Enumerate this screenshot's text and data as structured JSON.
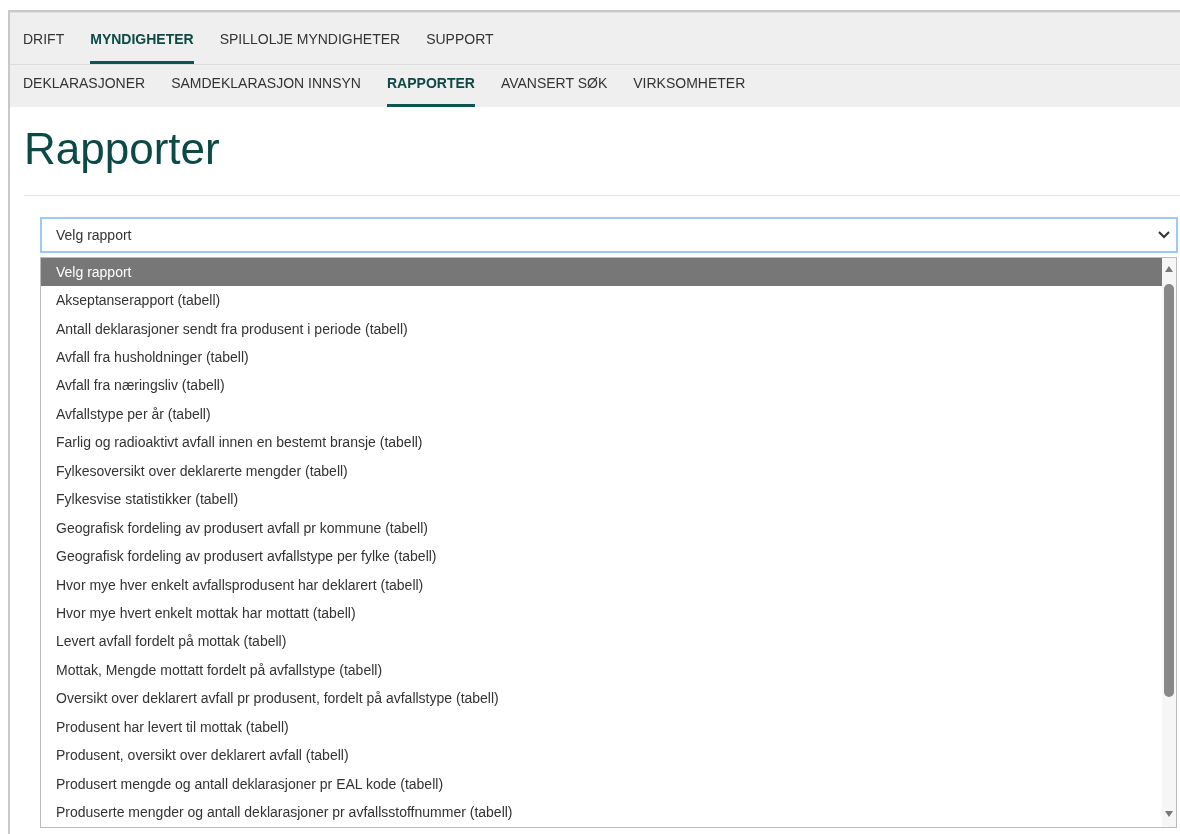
{
  "main_nav": [
    {
      "label": "DRIFT",
      "selected": false
    },
    {
      "label": "MYNDIGHETER",
      "selected": true
    },
    {
      "label": "SPILLOLJE MYNDIGHETER",
      "selected": false
    },
    {
      "label": "SUPPORT",
      "selected": false
    }
  ],
  "sub_nav": [
    {
      "label": "DEKLARASJONER",
      "selected": false
    },
    {
      "label": "SAMDEKLARASJON INNSYN",
      "selected": false
    },
    {
      "label": "RAPPORTER",
      "selected": true
    },
    {
      "label": "AVANSERT SØK",
      "selected": false
    },
    {
      "label": "VIRKSOMHETER",
      "selected": false
    }
  ],
  "page_title": "Rapporter",
  "report_select": {
    "value": "Velg rapport",
    "expanded": true,
    "options": [
      {
        "label": "Velg rapport",
        "selected": true
      },
      {
        "label": "Akseptanserapport (tabell)",
        "selected": false
      },
      {
        "label": "Antall deklarasjoner sendt fra produsent i periode (tabell)",
        "selected": false
      },
      {
        "label": "Avfall fra husholdninger (tabell)",
        "selected": false
      },
      {
        "label": "Avfall fra næringsliv (tabell)",
        "selected": false
      },
      {
        "label": "Avfallstype per år (tabell)",
        "selected": false
      },
      {
        "label": "Farlig og radioaktivt avfall innen en bestemt bransje (tabell)",
        "selected": false
      },
      {
        "label": "Fylkesoversikt over deklarerte mengder (tabell)",
        "selected": false
      },
      {
        "label": "Fylkesvise statistikker (tabell)",
        "selected": false
      },
      {
        "label": "Geografisk fordeling av produsert avfall pr kommune (tabell)",
        "selected": false
      },
      {
        "label": "Geografisk fordeling av produsert avfallstype per fylke (tabell)",
        "selected": false
      },
      {
        "label": "Hvor mye hver enkelt avfallsprodusent har deklarert (tabell)",
        "selected": false
      },
      {
        "label": "Hvor mye hvert enkelt mottak har mottatt (tabell)",
        "selected": false
      },
      {
        "label": "Levert avfall fordelt på mottak (tabell)",
        "selected": false
      },
      {
        "label": "Mottak, Mengde mottatt fordelt på avfallstype (tabell)",
        "selected": false
      },
      {
        "label": "Oversikt over deklarert avfall pr produsent, fordelt på avfallstype (tabell)",
        "selected": false
      },
      {
        "label": "Produsent har levert til mottak (tabell)",
        "selected": false
      },
      {
        "label": "Produsent, oversikt over deklarert avfall (tabell)",
        "selected": false
      },
      {
        "label": "Produsert mengde og antall deklarasjoner pr EAL kode (tabell)",
        "selected": false
      },
      {
        "label": "Produserte mengder og antall deklarasjoner pr avfallsstoffnummer (tabell)",
        "selected": false
      }
    ]
  }
}
